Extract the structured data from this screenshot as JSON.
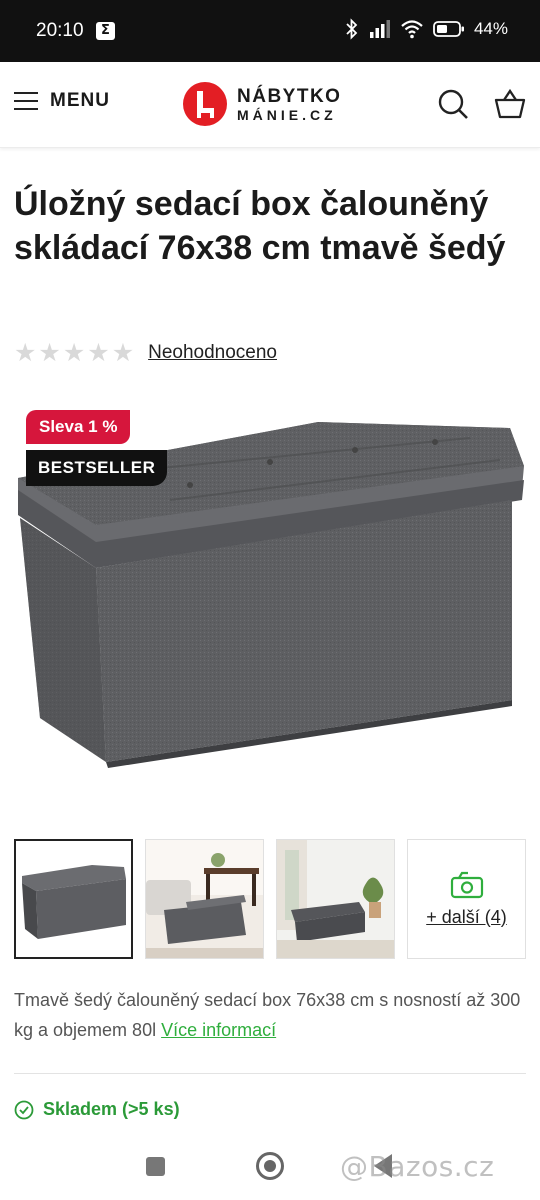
{
  "status_bar": {
    "time": "20:10",
    "notification_icon": "Σ",
    "battery_percent": "44%"
  },
  "header": {
    "menu_label": "MENU",
    "logo_line1": "NÁBYTKO",
    "logo_line2": "MÁNIE.CZ",
    "brand_color": "#e31e24"
  },
  "product": {
    "title": "Úložný sedací box čalouněný skládací 76x38 cm tmavě šedý",
    "rating_link": "Neohodnoceno",
    "stars_filled": 0,
    "badge_sale": "Sleva 1 %",
    "badge_bestseller": "BESTSELLER",
    "thumbnails_more": "+ další (4)",
    "description": "Tmavě šedý čalouněný sedací box 76x38 cm s nosností až 300 kg a objemem 80l",
    "more_info_link": "Více informací",
    "stock": "Skladem (>5 ks)"
  },
  "colors": {
    "sale_badge": "#d6163c",
    "stock_green": "#2b9a38",
    "link_green": "#2fae3d"
  },
  "watermark": "@Bazos.cz"
}
